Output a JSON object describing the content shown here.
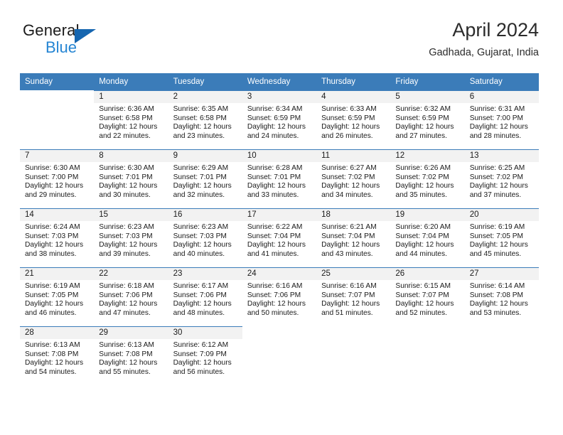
{
  "brand": {
    "name_top": "General",
    "name_bottom": "Blue",
    "accent_color": "#2585d3",
    "triangle_color": "#1666b0"
  },
  "header": {
    "title": "April 2024",
    "subtitle": "Gadhada, Gujarat, India"
  },
  "calendar": {
    "header_bg": "#3b7cb9",
    "daynum_bg": "#f2f2f2",
    "weekday_headers": [
      "Sunday",
      "Monday",
      "Tuesday",
      "Wednesday",
      "Thursday",
      "Friday",
      "Saturday"
    ],
    "weeks": [
      [
        {
          "day": "",
          "sunrise": "",
          "sunset": "",
          "daylight_line1": "",
          "daylight_line2": ""
        },
        {
          "day": "1",
          "sunrise": "Sunrise: 6:36 AM",
          "sunset": "Sunset: 6:58 PM",
          "daylight_line1": "Daylight: 12 hours",
          "daylight_line2": "and 22 minutes."
        },
        {
          "day": "2",
          "sunrise": "Sunrise: 6:35 AM",
          "sunset": "Sunset: 6:58 PM",
          "daylight_line1": "Daylight: 12 hours",
          "daylight_line2": "and 23 minutes."
        },
        {
          "day": "3",
          "sunrise": "Sunrise: 6:34 AM",
          "sunset": "Sunset: 6:59 PM",
          "daylight_line1": "Daylight: 12 hours",
          "daylight_line2": "and 24 minutes."
        },
        {
          "day": "4",
          "sunrise": "Sunrise: 6:33 AM",
          "sunset": "Sunset: 6:59 PM",
          "daylight_line1": "Daylight: 12 hours",
          "daylight_line2": "and 26 minutes."
        },
        {
          "day": "5",
          "sunrise": "Sunrise: 6:32 AM",
          "sunset": "Sunset: 6:59 PM",
          "daylight_line1": "Daylight: 12 hours",
          "daylight_line2": "and 27 minutes."
        },
        {
          "day": "6",
          "sunrise": "Sunrise: 6:31 AM",
          "sunset": "Sunset: 7:00 PM",
          "daylight_line1": "Daylight: 12 hours",
          "daylight_line2": "and 28 minutes."
        }
      ],
      [
        {
          "day": "7",
          "sunrise": "Sunrise: 6:30 AM",
          "sunset": "Sunset: 7:00 PM",
          "daylight_line1": "Daylight: 12 hours",
          "daylight_line2": "and 29 minutes."
        },
        {
          "day": "8",
          "sunrise": "Sunrise: 6:30 AM",
          "sunset": "Sunset: 7:01 PM",
          "daylight_line1": "Daylight: 12 hours",
          "daylight_line2": "and 30 minutes."
        },
        {
          "day": "9",
          "sunrise": "Sunrise: 6:29 AM",
          "sunset": "Sunset: 7:01 PM",
          "daylight_line1": "Daylight: 12 hours",
          "daylight_line2": "and 32 minutes."
        },
        {
          "day": "10",
          "sunrise": "Sunrise: 6:28 AM",
          "sunset": "Sunset: 7:01 PM",
          "daylight_line1": "Daylight: 12 hours",
          "daylight_line2": "and 33 minutes."
        },
        {
          "day": "11",
          "sunrise": "Sunrise: 6:27 AM",
          "sunset": "Sunset: 7:02 PM",
          "daylight_line1": "Daylight: 12 hours",
          "daylight_line2": "and 34 minutes."
        },
        {
          "day": "12",
          "sunrise": "Sunrise: 6:26 AM",
          "sunset": "Sunset: 7:02 PM",
          "daylight_line1": "Daylight: 12 hours",
          "daylight_line2": "and 35 minutes."
        },
        {
          "day": "13",
          "sunrise": "Sunrise: 6:25 AM",
          "sunset": "Sunset: 7:02 PM",
          "daylight_line1": "Daylight: 12 hours",
          "daylight_line2": "and 37 minutes."
        }
      ],
      [
        {
          "day": "14",
          "sunrise": "Sunrise: 6:24 AM",
          "sunset": "Sunset: 7:03 PM",
          "daylight_line1": "Daylight: 12 hours",
          "daylight_line2": "and 38 minutes."
        },
        {
          "day": "15",
          "sunrise": "Sunrise: 6:23 AM",
          "sunset": "Sunset: 7:03 PM",
          "daylight_line1": "Daylight: 12 hours",
          "daylight_line2": "and 39 minutes."
        },
        {
          "day": "16",
          "sunrise": "Sunrise: 6:23 AM",
          "sunset": "Sunset: 7:03 PM",
          "daylight_line1": "Daylight: 12 hours",
          "daylight_line2": "and 40 minutes."
        },
        {
          "day": "17",
          "sunrise": "Sunrise: 6:22 AM",
          "sunset": "Sunset: 7:04 PM",
          "daylight_line1": "Daylight: 12 hours",
          "daylight_line2": "and 41 minutes."
        },
        {
          "day": "18",
          "sunrise": "Sunrise: 6:21 AM",
          "sunset": "Sunset: 7:04 PM",
          "daylight_line1": "Daylight: 12 hours",
          "daylight_line2": "and 43 minutes."
        },
        {
          "day": "19",
          "sunrise": "Sunrise: 6:20 AM",
          "sunset": "Sunset: 7:04 PM",
          "daylight_line1": "Daylight: 12 hours",
          "daylight_line2": "and 44 minutes."
        },
        {
          "day": "20",
          "sunrise": "Sunrise: 6:19 AM",
          "sunset": "Sunset: 7:05 PM",
          "daylight_line1": "Daylight: 12 hours",
          "daylight_line2": "and 45 minutes."
        }
      ],
      [
        {
          "day": "21",
          "sunrise": "Sunrise: 6:19 AM",
          "sunset": "Sunset: 7:05 PM",
          "daylight_line1": "Daylight: 12 hours",
          "daylight_line2": "and 46 minutes."
        },
        {
          "day": "22",
          "sunrise": "Sunrise: 6:18 AM",
          "sunset": "Sunset: 7:06 PM",
          "daylight_line1": "Daylight: 12 hours",
          "daylight_line2": "and 47 minutes."
        },
        {
          "day": "23",
          "sunrise": "Sunrise: 6:17 AM",
          "sunset": "Sunset: 7:06 PM",
          "daylight_line1": "Daylight: 12 hours",
          "daylight_line2": "and 48 minutes."
        },
        {
          "day": "24",
          "sunrise": "Sunrise: 6:16 AM",
          "sunset": "Sunset: 7:06 PM",
          "daylight_line1": "Daylight: 12 hours",
          "daylight_line2": "and 50 minutes."
        },
        {
          "day": "25",
          "sunrise": "Sunrise: 6:16 AM",
          "sunset": "Sunset: 7:07 PM",
          "daylight_line1": "Daylight: 12 hours",
          "daylight_line2": "and 51 minutes."
        },
        {
          "day": "26",
          "sunrise": "Sunrise: 6:15 AM",
          "sunset": "Sunset: 7:07 PM",
          "daylight_line1": "Daylight: 12 hours",
          "daylight_line2": "and 52 minutes."
        },
        {
          "day": "27",
          "sunrise": "Sunrise: 6:14 AM",
          "sunset": "Sunset: 7:08 PM",
          "daylight_line1": "Daylight: 12 hours",
          "daylight_line2": "and 53 minutes."
        }
      ],
      [
        {
          "day": "28",
          "sunrise": "Sunrise: 6:13 AM",
          "sunset": "Sunset: 7:08 PM",
          "daylight_line1": "Daylight: 12 hours",
          "daylight_line2": "and 54 minutes."
        },
        {
          "day": "29",
          "sunrise": "Sunrise: 6:13 AM",
          "sunset": "Sunset: 7:08 PM",
          "daylight_line1": "Daylight: 12 hours",
          "daylight_line2": "and 55 minutes."
        },
        {
          "day": "30",
          "sunrise": "Sunrise: 6:12 AM",
          "sunset": "Sunset: 7:09 PM",
          "daylight_line1": "Daylight: 12 hours",
          "daylight_line2": "and 56 minutes."
        },
        {
          "day": "",
          "sunrise": "",
          "sunset": "",
          "daylight_line1": "",
          "daylight_line2": ""
        },
        {
          "day": "",
          "sunrise": "",
          "sunset": "",
          "daylight_line1": "",
          "daylight_line2": ""
        },
        {
          "day": "",
          "sunrise": "",
          "sunset": "",
          "daylight_line1": "",
          "daylight_line2": ""
        },
        {
          "day": "",
          "sunrise": "",
          "sunset": "",
          "daylight_line1": "",
          "daylight_line2": ""
        }
      ]
    ]
  }
}
